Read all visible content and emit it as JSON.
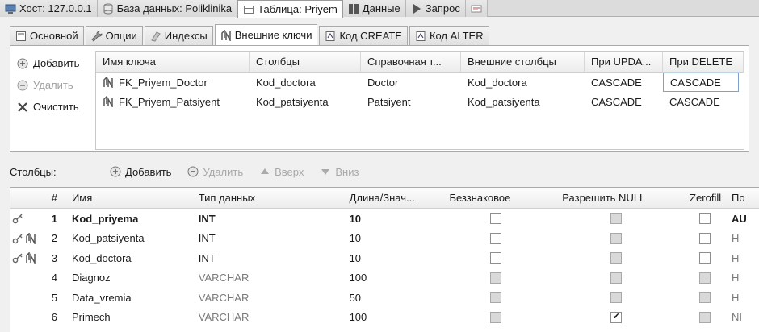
{
  "top_tabs": [
    {
      "label": "Хост: 127.0.0.1",
      "icon": "host-icon"
    },
    {
      "label": "База данных: Poliklinika",
      "icon": "database-icon"
    },
    {
      "label": "Таблица: Priyem",
      "icon": "table-icon"
    },
    {
      "label": "Данные",
      "icon": "data-grid-icon"
    },
    {
      "label": "Запрос",
      "icon": "play-icon"
    },
    {
      "label": "",
      "icon": "query-extra-icon"
    }
  ],
  "sub_tabs": [
    {
      "label": "Основной",
      "icon": "basic-icon"
    },
    {
      "label": "Опции",
      "icon": "wrench-icon"
    },
    {
      "label": "Индексы",
      "icon": "index-icon"
    },
    {
      "label": "Внешние ключи",
      "icon": "foreign-key-icon"
    },
    {
      "label": "Код CREATE",
      "icon": "code-icon"
    },
    {
      "label": "Код ALTER",
      "icon": "code-icon"
    }
  ],
  "fk_actions": {
    "add": "Добавить",
    "remove": "Удалить",
    "clear": "Очистить"
  },
  "fk_table": {
    "headers": [
      "Имя ключа",
      "Столбцы",
      "Справочная т...",
      "Внешние столбцы",
      "При UPDA...",
      "При DELETE"
    ],
    "rows": [
      [
        "FK_Priyem_Doctor",
        "Kod_doctora",
        "Doctor",
        "Kod_doctora",
        "CASCADE",
        "CASCADE"
      ],
      [
        "FK_Priyem_Patsiyent",
        "Kod_patsiyenta",
        "Patsiyent",
        "Kod_patsiyenta",
        "CASCADE",
        "CASCADE"
      ]
    ]
  },
  "columns_toolbar": {
    "label": "Столбцы:",
    "add": "Добавить",
    "remove": "Удалить",
    "up": "Вверх",
    "down": "Вниз"
  },
  "columns_table": {
    "headers": {
      "num": "#",
      "name": "Имя",
      "type": "Тип данных",
      "length": "Длина/Знач...",
      "unsigned": "Беззнаковое",
      "allow_null": "Разрешить NULL",
      "zerofill": "Zerofill",
      "default": "По"
    },
    "rows": [
      {
        "num": "1",
        "name": "Kod_priyema",
        "type": "INT",
        "length": "10",
        "unsigned": false,
        "allow_null": false,
        "zerofill": false,
        "default": "AU",
        "key": true,
        "fk": false,
        "bold": true,
        "numeric": true
      },
      {
        "num": "2",
        "name": "Kod_patsiyenta",
        "type": "INT",
        "length": "10",
        "unsigned": false,
        "allow_null": false,
        "zerofill": false,
        "default": "Н",
        "key": true,
        "fk": true,
        "bold": false,
        "numeric": true
      },
      {
        "num": "3",
        "name": "Kod_doctora",
        "type": "INT",
        "length": "10",
        "unsigned": false,
        "allow_null": false,
        "zerofill": false,
        "default": "Н",
        "key": true,
        "fk": true,
        "bold": false,
        "numeric": true
      },
      {
        "num": "4",
        "name": "Diagnoz",
        "type": "VARCHAR",
        "length": "100",
        "unsigned": false,
        "allow_null": false,
        "zerofill": false,
        "default": "Н",
        "key": false,
        "fk": false,
        "bold": false,
        "numeric": false
      },
      {
        "num": "5",
        "name": "Data_vremia",
        "type": "VARCHAR",
        "length": "50",
        "unsigned": false,
        "allow_null": false,
        "zerofill": false,
        "default": "Н",
        "key": false,
        "fk": false,
        "bold": false,
        "numeric": false
      },
      {
        "num": "6",
        "name": "Primech",
        "type": "VARCHAR",
        "length": "100",
        "unsigned": false,
        "allow_null": true,
        "zerofill": false,
        "default": "NI",
        "key": false,
        "fk": false,
        "bold": false,
        "numeric": false
      }
    ]
  }
}
